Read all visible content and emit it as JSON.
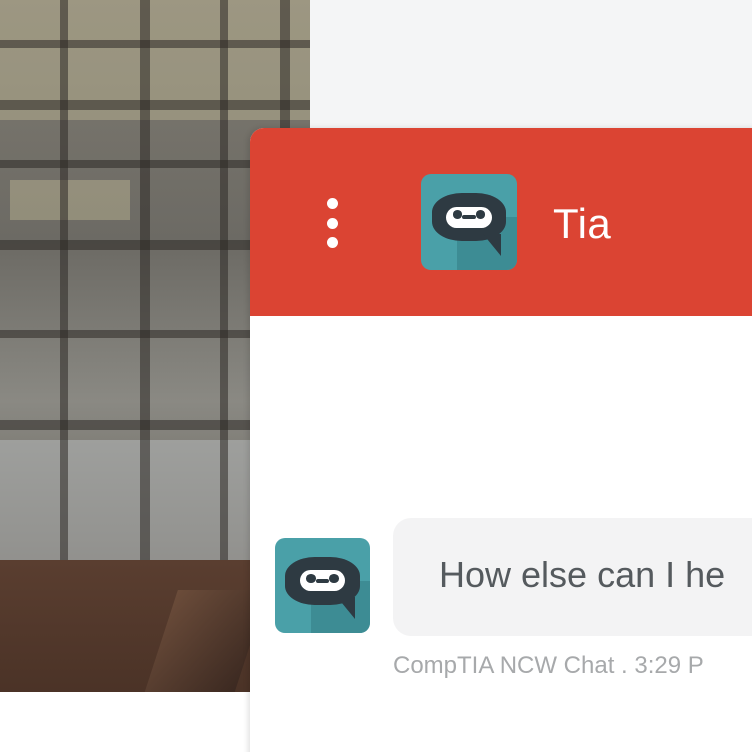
{
  "colors": {
    "header_bg": "#db4433",
    "avatar_teal": "#4aa0a8",
    "bubble_bg": "#f3f3f4"
  },
  "header": {
    "menu_icon": "kebab-menu-icon",
    "bot_name": "Tia",
    "avatar_icon": "chatbot-avatar-icon"
  },
  "messages": [
    {
      "sender_icon": "chatbot-avatar-icon",
      "text": "How else can I he",
      "meta": "CompTIA NCW Chat . 3:29 P"
    }
  ]
}
